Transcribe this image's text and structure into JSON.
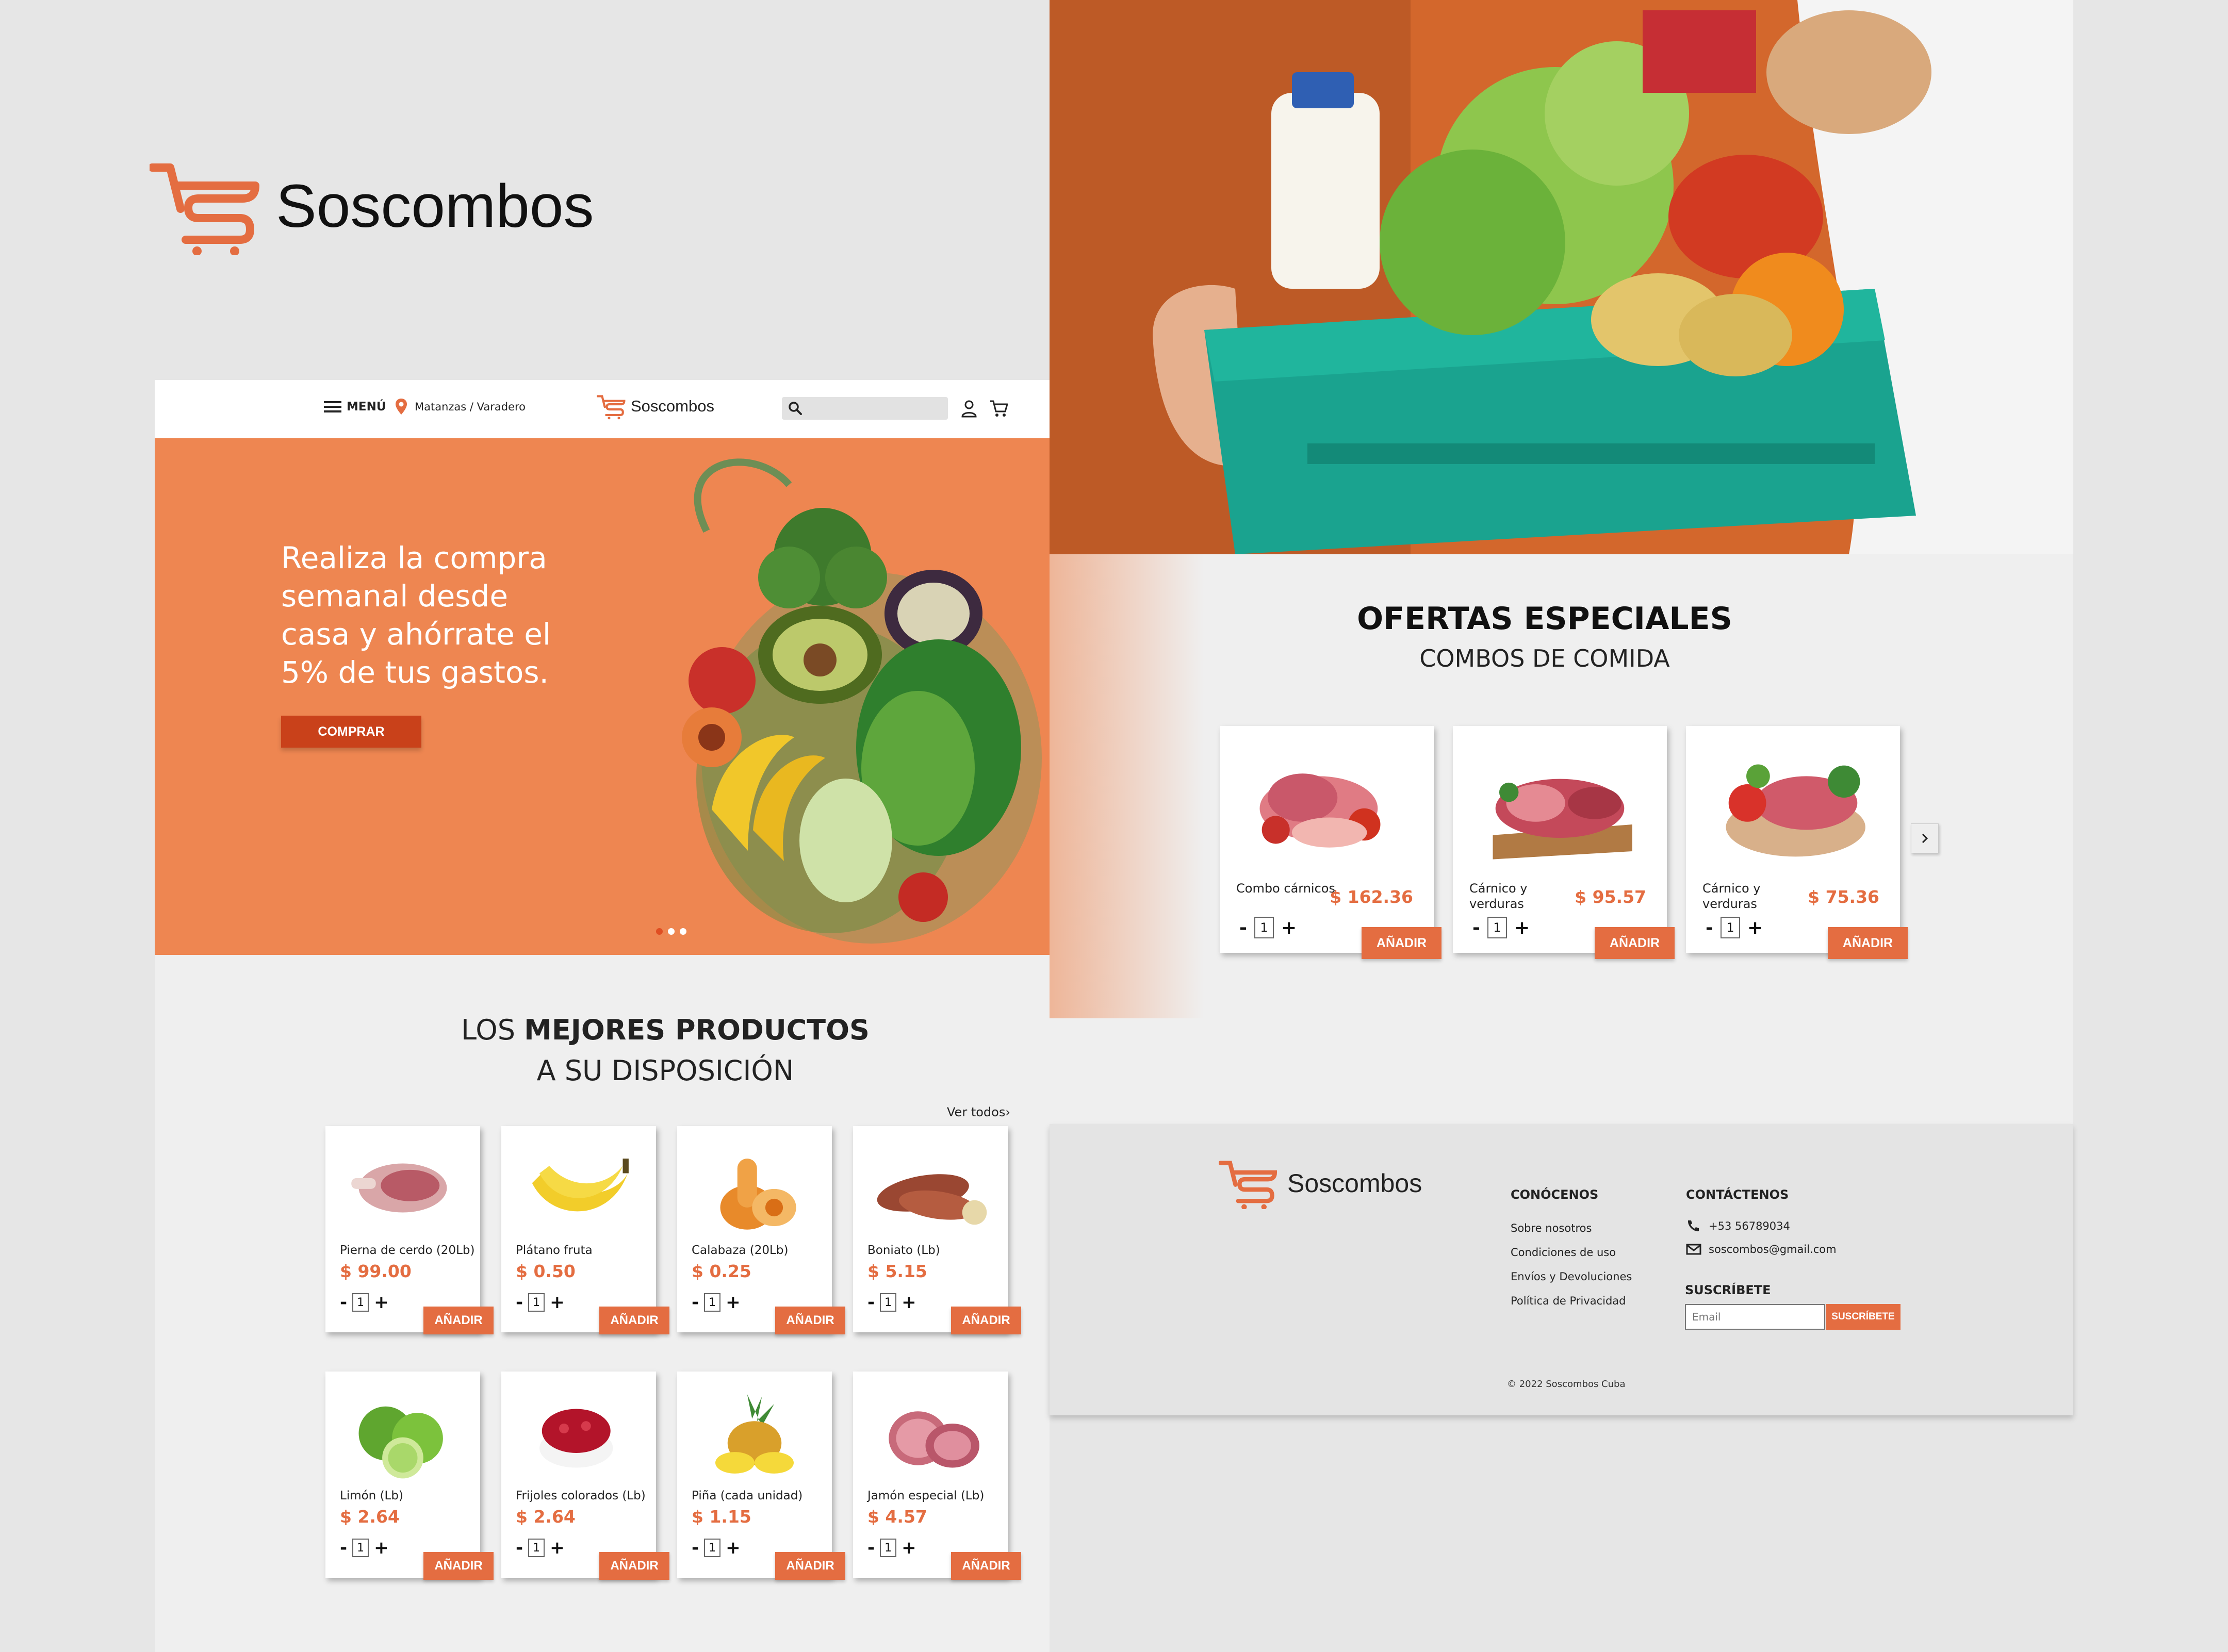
{
  "brand": {
    "name": "Soscombos",
    "accent": "#e46d41"
  },
  "nav": {
    "menu_label": "MENÚ",
    "location": "Matanzas / Varadero",
    "logo_text": "Soscombos",
    "search_placeholder": ""
  },
  "hero": {
    "text": "Realiza la compra semanal desde casa y ahórrate el 5% de tus gastos.",
    "button": "COMPRAR",
    "slides": 3,
    "active_slide": 1
  },
  "best": {
    "title_prefix": "LOS ",
    "title_bold": "MEJORES PRODUCTOS",
    "subtitle": "A SU DISPOSICIÓN",
    "see_all": "Ver todos›",
    "products": [
      {
        "name": "Pierna de cerdo (20Lb)",
        "price": "$ 99.00",
        "qty": "1",
        "add": "AÑADIR",
        "icon": "pork-leg"
      },
      {
        "name": "Plátano fruta",
        "price": "$ 0.50",
        "qty": "1",
        "add": "AÑADIR",
        "icon": "banana"
      },
      {
        "name": "Calabaza (20Lb)",
        "price": "$ 0.25",
        "qty": "1",
        "add": "AÑADIR",
        "icon": "squash"
      },
      {
        "name": "Boniato  (Lb)",
        "price": "$ 5.15",
        "qty": "1",
        "add": "AÑADIR",
        "icon": "sweet-potato"
      },
      {
        "name": "Limón (Lb)",
        "price": "$ 2.64",
        "qty": "1",
        "add": "AÑADIR",
        "icon": "lime"
      },
      {
        "name": "Frijoles colorados (Lb)",
        "price": "$ 2.64",
        "qty": "1",
        "add": "AÑADIR",
        "icon": "red-beans"
      },
      {
        "name": "Piña (cada unidad)",
        "price": "$ 1.15",
        "qty": "1",
        "add": "AÑADIR",
        "icon": "pineapple"
      },
      {
        "name": "Jamón especial  (Lb)",
        "price": "$ 4.57",
        "qty": "1",
        "add": "AÑADIR",
        "icon": "ham"
      }
    ]
  },
  "offers": {
    "title": "OFERTAS ESPECIALES",
    "subtitle": "COMBOS DE COMIDA",
    "items": [
      {
        "name": "Combo cárnicos",
        "price": "$ 162.36",
        "qty": "1",
        "add": "AÑADIR",
        "icon": "meat-combo"
      },
      {
        "name": "Cárnico y verduras",
        "price": "$ 95.57",
        "qty": "1",
        "add": "AÑADIR",
        "icon": "meat-board"
      },
      {
        "name": "Cárnico y verduras",
        "price": "$ 75.36",
        "qty": "1",
        "add": "AÑADIR",
        "icon": "meat-veg-platter"
      }
    ]
  },
  "footer": {
    "logo_text": "Soscombos",
    "about_heading": "CONÓCENOS",
    "about_links": [
      "Sobre nosotros",
      "Condiciones de uso",
      "Envíos y Devoluciones",
      "Política de Privacidad"
    ],
    "contact_heading": "CONTÁCTENOS",
    "phone": "+53 56789034",
    "email": "soscombos@gmail.com",
    "subscribe_heading": "SUSCRÍBETE",
    "email_placeholder": "Email",
    "subscribe_button": "SUSCRÍBETE",
    "copyright": "© 2022 Soscombos Cuba"
  }
}
